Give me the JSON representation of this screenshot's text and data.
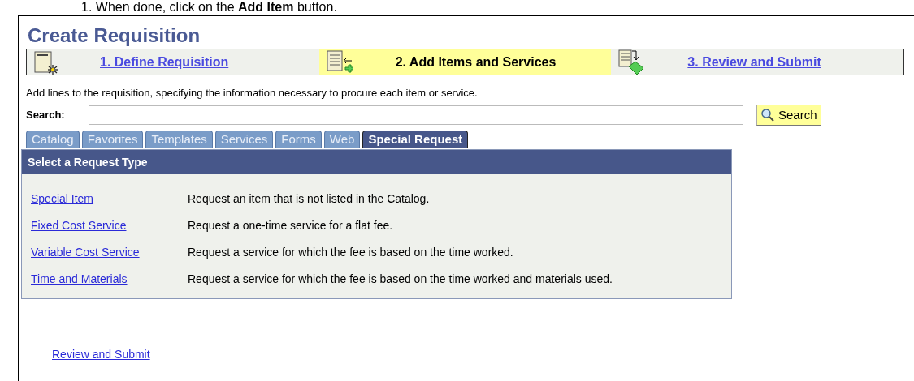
{
  "instruction": "1.    When done, click on the **Add Item** button.",
  "title": "Create Requisition",
  "steps": [
    {
      "label": "1. Define Requisition",
      "selected": false,
      "kind": "define"
    },
    {
      "label": "2. Add Items and Services",
      "selected": true,
      "kind": "add"
    },
    {
      "label": "3. Review and Submit",
      "selected": false,
      "kind": "review"
    }
  ],
  "description": "Add lines to the requisition, specifying the information necessary to procure each item or service.",
  "search": {
    "label": "Search:",
    "button": "Search"
  },
  "tabs": [
    {
      "label": "Catalog",
      "selected": false
    },
    {
      "label": "Favorites",
      "selected": false
    },
    {
      "label": "Templates",
      "selected": false
    },
    {
      "label": "Services",
      "selected": false
    },
    {
      "label": "Forms",
      "selected": false
    },
    {
      "label": "Web",
      "selected": false
    },
    {
      "label": "Special Request",
      "selected": true
    }
  ],
  "panel": {
    "title": "Select a Request Type",
    "rows": [
      {
        "link": "Special Item",
        "text": "Request an item that is not listed in the Catalog."
      },
      {
        "link": "Fixed Cost Service",
        "text": "Request a one-time service for a flat fee."
      },
      {
        "link": "Variable Cost Service",
        "text": "Request a service for which the fee is based on the time worked."
      },
      {
        "link": "Time and Materials",
        "text": "Request a service for which the fee is based on the time worked and materials used."
      }
    ]
  },
  "footer_link": "Review and Submit"
}
